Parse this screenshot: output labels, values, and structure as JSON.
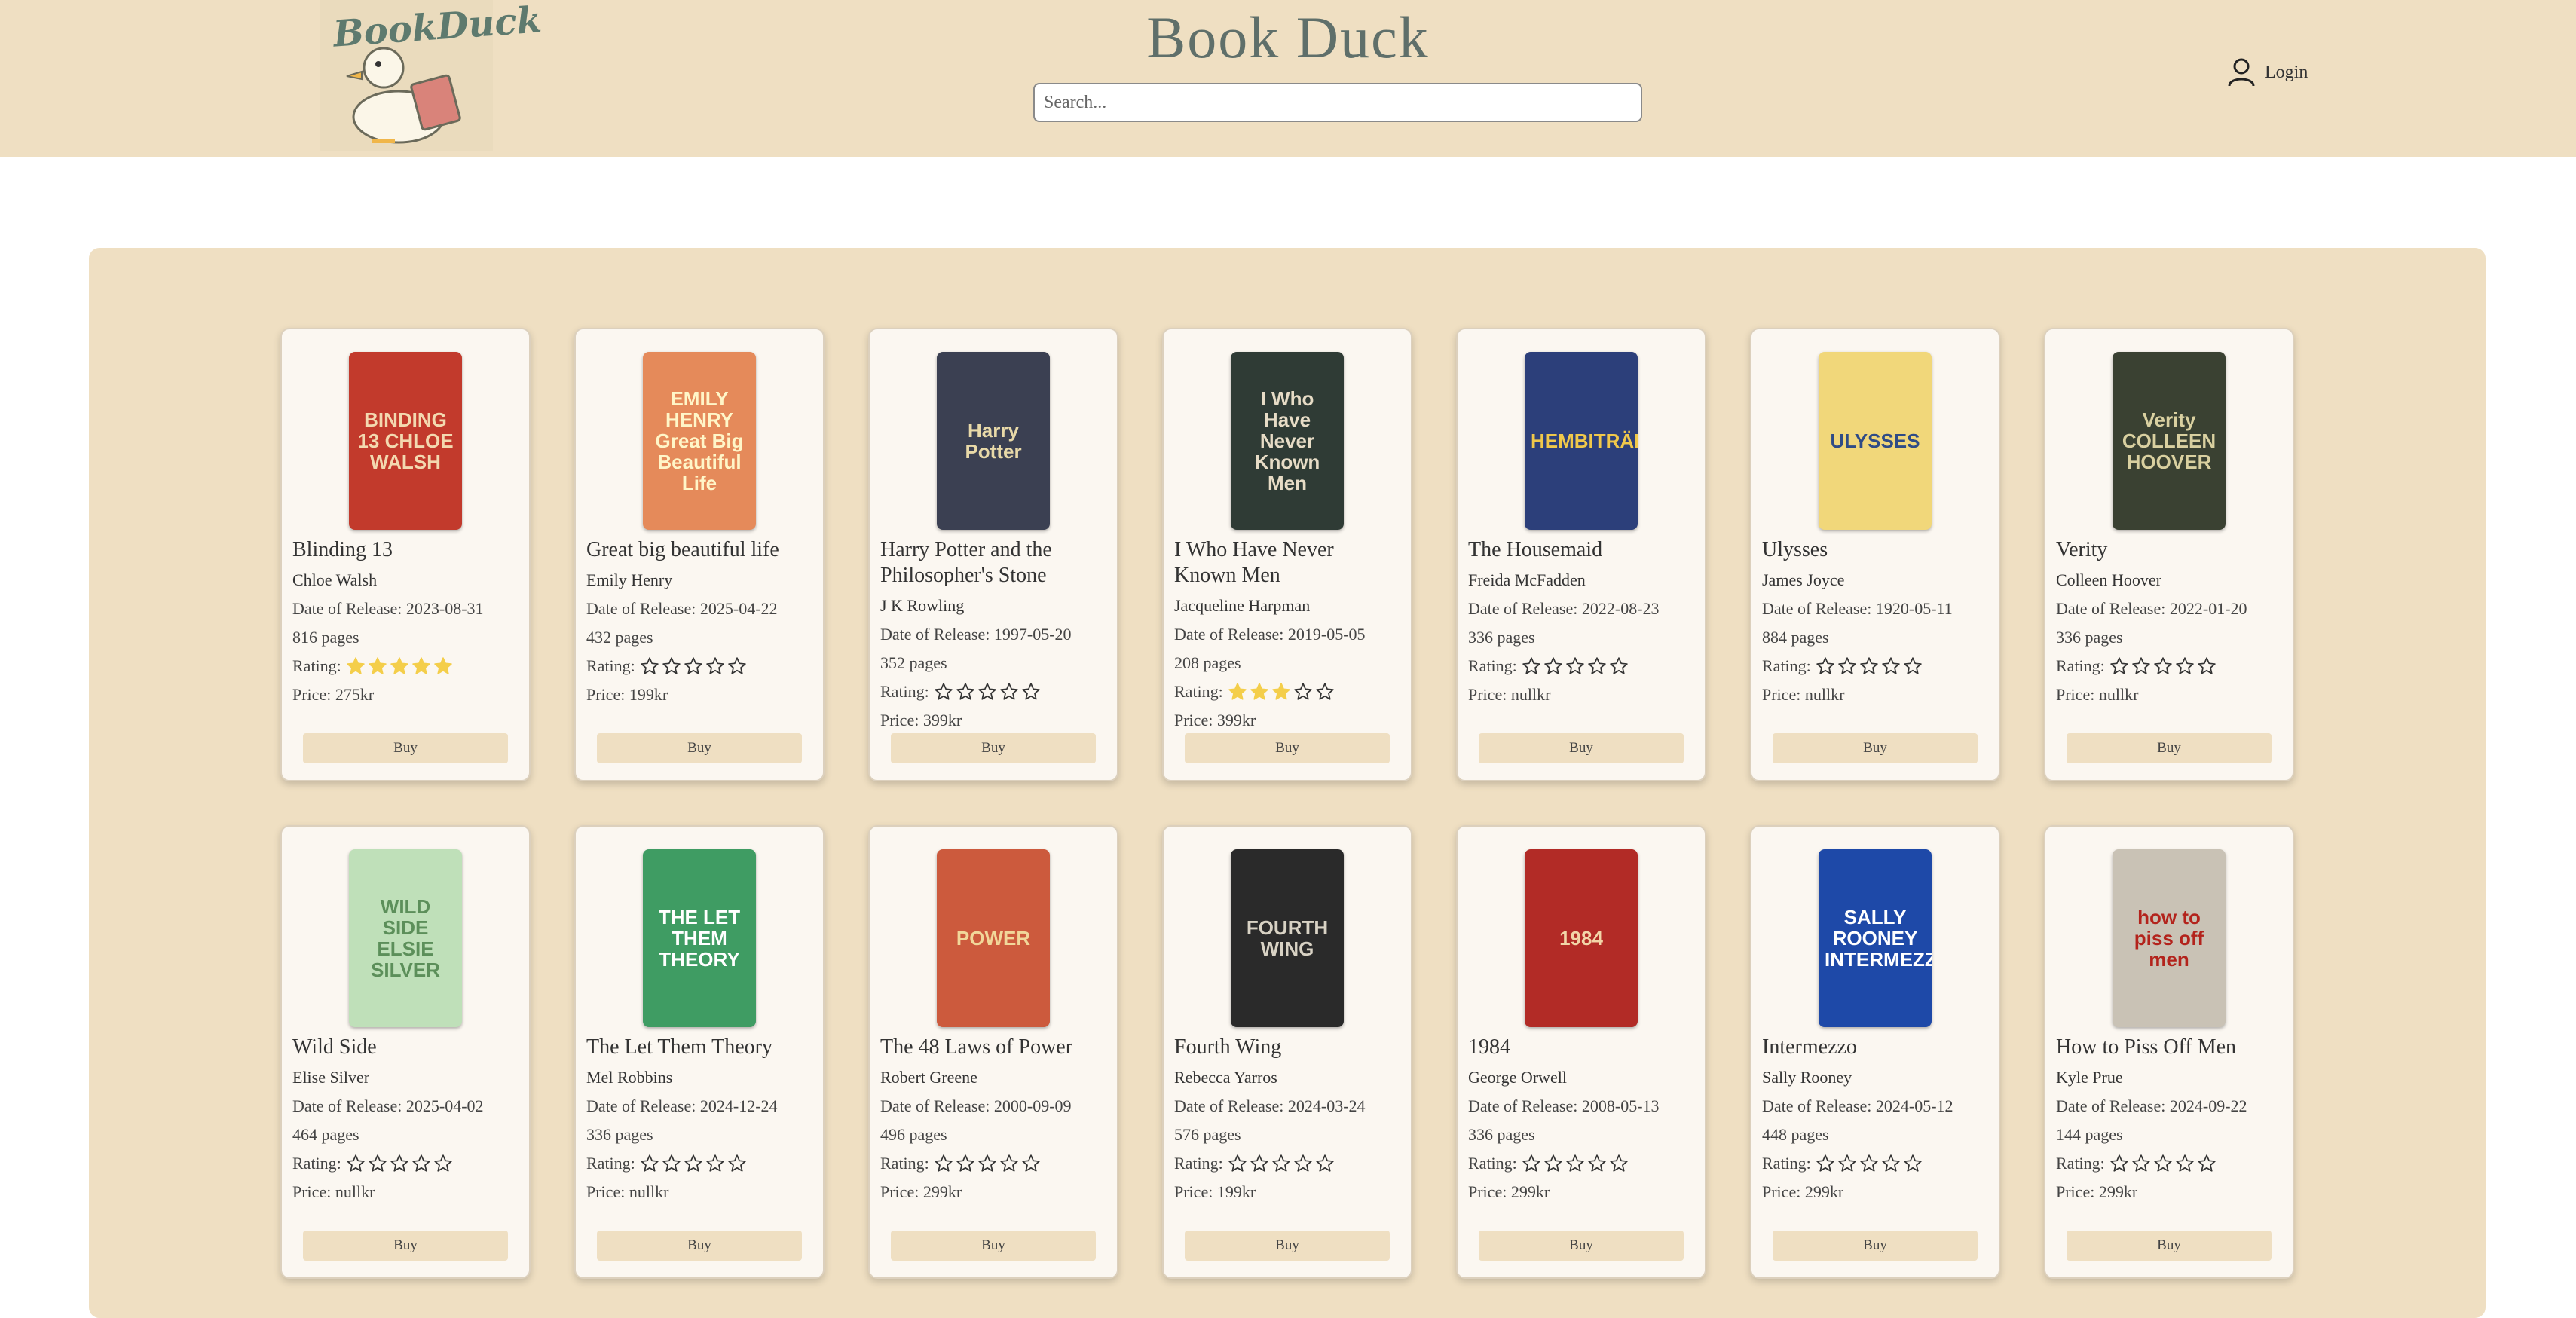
{
  "header": {
    "logo_text": "BookDuck",
    "title": "Book Duck",
    "search_placeholder": "Search...",
    "login_label": "Login"
  },
  "colors": {
    "header_bg": "#efdfc2",
    "panel_bg": "#efdfc2",
    "card_bg": "#fbf7f1",
    "star_fill": "#f4ce4a"
  },
  "labels": {
    "release_prefix": "Date of Release: ",
    "pages_suffix": " pages",
    "rating_prefix": "Rating:",
    "price_prefix": "Price: ",
    "price_suffix": "kr",
    "buy": "Buy"
  },
  "books": [
    {
      "title": "Blinding 13",
      "author": "Chloe Walsh",
      "release": "2023-08-31",
      "pages": "816",
      "rating": 5,
      "price": "275",
      "cover_text": "BINDING 13 CHLOE WALSH",
      "cover_bg": "#c23a2c",
      "cover_fg": "#f3d9b0"
    },
    {
      "title": "Great big beautiful life",
      "author": "Emily Henry",
      "release": "2025-04-22",
      "pages": "432",
      "rating": 0,
      "price": "199",
      "cover_text": "EMILY HENRY Great Big Beautiful Life",
      "cover_bg": "#e58a5a",
      "cover_fg": "#fff6c8"
    },
    {
      "title": "Harry Potter and the Philosopher's Stone",
      "author": "J K Rowling",
      "release": "1997-05-20",
      "pages": "352",
      "rating": 0,
      "price": "399",
      "cover_text": "Harry Potter",
      "cover_bg": "#3b4052",
      "cover_fg": "#e8d9a8"
    },
    {
      "title": "I Who Have Never Known Men",
      "author": "Jacqueline Harpman",
      "release": "2019-05-05",
      "pages": "208",
      "rating": 3,
      "price": "399",
      "cover_text": "I Who Have Never Known Men",
      "cover_bg": "#2f3b35",
      "cover_fg": "#e7dcc6"
    },
    {
      "title": "The Housemaid",
      "author": "Freida McFadden",
      "release": "2022-08-23",
      "pages": "336",
      "rating": 0,
      "price": "null",
      "cover_text": "HEMBITRÄDET",
      "cover_bg": "#2c3f7a",
      "cover_fg": "#f0c84a"
    },
    {
      "title": "Ulysses",
      "author": "James Joyce",
      "release": "1920-05-11",
      "pages": "884",
      "rating": 0,
      "price": "null",
      "cover_text": "ULYSSES",
      "cover_bg": "#f1d77a",
      "cover_fg": "#2f4b86"
    },
    {
      "title": "Verity",
      "author": "Colleen Hoover",
      "release": "2022-01-20",
      "pages": "336",
      "rating": 0,
      "price": "null",
      "cover_text": "Verity COLLEEN HOOVER",
      "cover_bg": "#3a4132",
      "cover_fg": "#d9d0a0"
    },
    {
      "title": "Wild Side",
      "author": "Elise Silver",
      "release": "2025-04-02",
      "pages": "464",
      "rating": 0,
      "price": "null",
      "cover_text": "WILD SIDE ELSIE SILVER",
      "cover_bg": "#bfe0b9",
      "cover_fg": "#5c8f5a"
    },
    {
      "title": "The Let Them Theory",
      "author": "Mel Robbins",
      "release": "2024-12-24",
      "pages": "336",
      "rating": 0,
      "price": "null",
      "cover_text": "THE LET THEM THEORY",
      "cover_bg": "#3f9c63",
      "cover_fg": "#ffffff"
    },
    {
      "title": "The 48 Laws of Power",
      "author": "Robert Greene",
      "release": "2000-09-09",
      "pages": "496",
      "rating": 0,
      "price": "299",
      "cover_text": "POWER",
      "cover_bg": "#cc5a3d",
      "cover_fg": "#f1d79a"
    },
    {
      "title": "Fourth Wing",
      "author": "Rebecca Yarros",
      "release": "2024-03-24",
      "pages": "576",
      "rating": 0,
      "price": "199",
      "cover_text": "FOURTH WING",
      "cover_bg": "#2a2a2a",
      "cover_fg": "#d8d2c4"
    },
    {
      "title": "1984",
      "author": "George Orwell",
      "release": "2008-05-13",
      "pages": "336",
      "rating": 0,
      "price": "299",
      "cover_text": "1984",
      "cover_bg": "#b22b26",
      "cover_fg": "#f2d5a8"
    },
    {
      "title": "Intermezzo",
      "author": "Sally Rooney",
      "release": "2024-05-12",
      "pages": "448",
      "rating": 0,
      "price": "299",
      "cover_text": "SALLY ROONEY INTERMEZZO",
      "cover_bg": "#1e49a8",
      "cover_fg": "#ffffff"
    },
    {
      "title": "How to Piss Off Men",
      "author": "Kyle Prue",
      "release": "2024-09-22",
      "pages": "144",
      "rating": 0,
      "price": "299",
      "cover_text": "how to piss off men",
      "cover_bg": "#c9c2b5",
      "cover_fg": "#b3231c"
    }
  ]
}
